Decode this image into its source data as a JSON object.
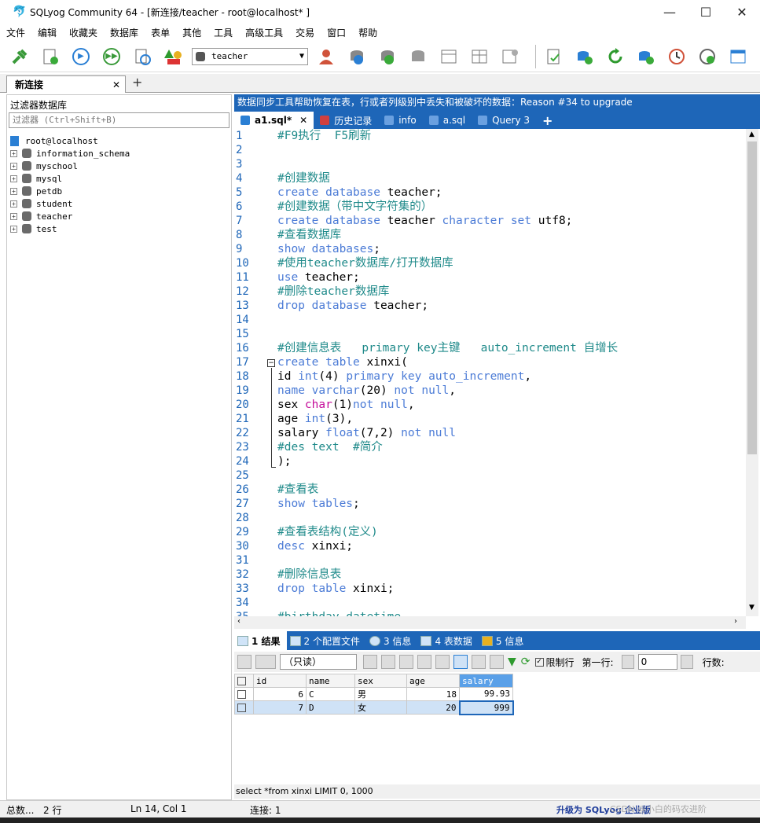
{
  "window": {
    "title": "SQLyog Community 64 - [新连接/teacher - root@localhost* ]",
    "minimize": "—",
    "maximize": "☐",
    "close": "✕"
  },
  "menu": [
    "文件",
    "编辑",
    "收藏夹",
    "数据库",
    "表单",
    "其他",
    "工具",
    "高级工具",
    "交易",
    "窗口",
    "帮助"
  ],
  "toolbar": {
    "db_selector": "teacher"
  },
  "connection_tab": {
    "label": "新连接",
    "close": "✕",
    "add": "+"
  },
  "object_browser": {
    "header": "过滤器数据库",
    "filter_placeholder": "过滤器 (Ctrl+Shift+B)",
    "root": "root@localhost",
    "databases": [
      "information_schema",
      "myschool",
      "mysql",
      "petdb",
      "student",
      "teacher",
      "test"
    ]
  },
  "banner": "数据同步工具帮助恢复在表，行或者列级别中丢失和被破坏的数据：Reason #34 to upgrade",
  "query_tabs": [
    {
      "label": "a1.sql*",
      "close": "✕",
      "icon_color": "#2a7fd4"
    },
    {
      "label": "历史记录",
      "icon_color": "#d04040"
    },
    {
      "label": "info",
      "icon_color": "#6aa0e0"
    },
    {
      "label": "a.sql",
      "icon_color": "#6aa0e0"
    },
    {
      "label": "Query 3",
      "icon_color": "#6aa0e0"
    }
  ],
  "query_tab_add": "+",
  "editor": {
    "line_numbers": [
      "1",
      "2",
      "3",
      "4",
      "5",
      "6",
      "7",
      "8",
      "9",
      "10",
      "11",
      "12",
      "13",
      "14",
      "15",
      "16",
      "17",
      "18",
      "19",
      "20",
      "21",
      "22",
      "23",
      "24",
      "25",
      "26",
      "27",
      "28",
      "29",
      "30",
      "31",
      "32",
      "33",
      "34",
      "35"
    ],
    "lines": [
      [
        {
          "t": "#F9执行  F5刷新",
          "c": "cm"
        }
      ],
      [],
      [],
      [
        {
          "t": "#创建数据",
          "c": "cm"
        }
      ],
      [
        {
          "t": "create database ",
          "c": "kw"
        },
        {
          "t": "teacher;",
          "c": "pl"
        }
      ],
      [
        {
          "t": "#创建数据（带中文字符集的）",
          "c": "cm"
        }
      ],
      [
        {
          "t": "create database ",
          "c": "kw"
        },
        {
          "t": "teacher ",
          "c": "pl"
        },
        {
          "t": "character set ",
          "c": "kw"
        },
        {
          "t": "utf8;",
          "c": "pl"
        }
      ],
      [
        {
          "t": "#查看数据库",
          "c": "cm"
        }
      ],
      [
        {
          "t": "show databases",
          "c": "kw"
        },
        {
          "t": ";",
          "c": "pl"
        }
      ],
      [
        {
          "t": "#使用teacher数据库/打开数据库",
          "c": "cm"
        }
      ],
      [
        {
          "t": "use ",
          "c": "kw"
        },
        {
          "t": "teacher;",
          "c": "pl"
        }
      ],
      [
        {
          "t": "#删除teacher数据库",
          "c": "cm"
        }
      ],
      [
        {
          "t": "drop database ",
          "c": "kw"
        },
        {
          "t": "teacher;",
          "c": "pl"
        }
      ],
      [],
      [],
      [
        {
          "t": "#创建信息表   primary key主键   auto_increment 自增长",
          "c": "cm"
        }
      ],
      [
        {
          "t": "create table ",
          "c": "kw"
        },
        {
          "t": "xinxi(",
          "c": "pl"
        }
      ],
      [
        {
          "t": "id ",
          "c": "pl"
        },
        {
          "t": "int",
          "c": "kw"
        },
        {
          "t": "(4) ",
          "c": "pl"
        },
        {
          "t": "primary key auto_increment",
          "c": "kw"
        },
        {
          "t": ",",
          "c": "pl"
        }
      ],
      [
        {
          "t": "name ",
          "c": "kw"
        },
        {
          "t": "varchar",
          "c": "kw"
        },
        {
          "t": "(20) ",
          "c": "pl"
        },
        {
          "t": "not null",
          "c": "kw"
        },
        {
          "t": ",",
          "c": "pl"
        }
      ],
      [
        {
          "t": "sex ",
          "c": "pl"
        },
        {
          "t": "char",
          "c": "ty"
        },
        {
          "t": "(1)",
          "c": "pl"
        },
        {
          "t": "not null",
          "c": "kw"
        },
        {
          "t": ",",
          "c": "pl"
        }
      ],
      [
        {
          "t": "age ",
          "c": "pl"
        },
        {
          "t": "int",
          "c": "kw"
        },
        {
          "t": "(3),",
          "c": "pl"
        }
      ],
      [
        {
          "t": "salary ",
          "c": "pl"
        },
        {
          "t": "float",
          "c": "kw"
        },
        {
          "t": "(7,2) ",
          "c": "pl"
        },
        {
          "t": "not null",
          "c": "kw"
        }
      ],
      [
        {
          "t": "#des text  #简介",
          "c": "cm"
        }
      ],
      [
        {
          "t": ");",
          "c": "pl"
        }
      ],
      [],
      [
        {
          "t": "#查看表",
          "c": "cm"
        }
      ],
      [
        {
          "t": "show tables",
          "c": "kw"
        },
        {
          "t": ";",
          "c": "pl"
        }
      ],
      [],
      [
        {
          "t": "#查看表结构(定义)",
          "c": "cm"
        }
      ],
      [
        {
          "t": "desc ",
          "c": "kw"
        },
        {
          "t": "xinxi;",
          "c": "pl"
        }
      ],
      [],
      [
        {
          "t": "#删除信息表",
          "c": "cm"
        }
      ],
      [
        {
          "t": "drop table ",
          "c": "kw"
        },
        {
          "t": "xinxi;",
          "c": "pl"
        }
      ],
      [],
      [
        {
          "t": "#birthday datetime",
          "c": "cm"
        }
      ]
    ]
  },
  "result_tabs": [
    "1 结果",
    "2 个配置文件",
    "3 信息",
    "4 表数据",
    "5 信息"
  ],
  "result_toolbar": {
    "mode": "（只读）",
    "limit_rows": "限制行",
    "first_row_label": "第一行:",
    "first_row_value": "0",
    "rows_label": "行数:"
  },
  "result_grid": {
    "columns": [
      "id",
      "name",
      "sex",
      "age",
      "salary"
    ],
    "rows": [
      [
        "6",
        "C",
        "男",
        "18",
        "99.93"
      ],
      [
        "7",
        "D",
        "女",
        "20",
        "999"
      ]
    ]
  },
  "query_info": "select *from xinxi LIMIT 0, 1000",
  "statusbar": {
    "total": "总数...",
    "rows": "2 行",
    "position": "Ln 14, Col 1",
    "connections": "连接: 1",
    "upgrade": "升级为 SQLyog 企业版",
    "watermark": "CSDN @小白的码农进阶"
  }
}
